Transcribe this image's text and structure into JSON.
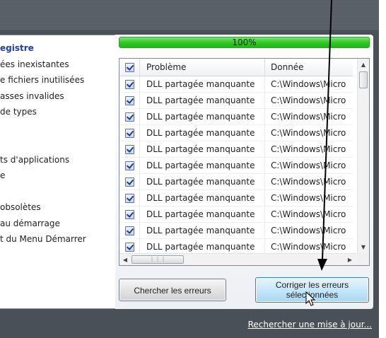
{
  "left_list": [
    {
      "text": "egistre",
      "head": true
    },
    {
      "text": "ées inexistantes"
    },
    {
      "text": "e fichiers inutilisées"
    },
    {
      "text": "asses invalides"
    },
    {
      "text": "de types"
    },
    {
      "text": ""
    },
    {
      "text": ""
    },
    {
      "text": "ts d'applications"
    },
    {
      "text": "e"
    },
    {
      "text": ""
    },
    {
      "text": "obsolètes"
    },
    {
      "text": "au démarrage"
    },
    {
      "text": "t du Menu Démarrer"
    }
  ],
  "progress": {
    "label": "100%",
    "value": 1.0
  },
  "grid": {
    "headers": {
      "check": "",
      "problem": "Problème",
      "data": "Donnée"
    },
    "rows": [
      {
        "problem": "DLL partagée manquante",
        "data": "C:\\Windows\\Micro"
      },
      {
        "problem": "DLL partagée manquante",
        "data": "C:\\Windows\\Micro"
      },
      {
        "problem": "DLL partagée manquante",
        "data": "C:\\Windows\\Micro"
      },
      {
        "problem": "DLL partagée manquante",
        "data": "C:\\Windows\\Micro"
      },
      {
        "problem": "DLL partagée manquante",
        "data": "C:\\Windows\\Micro"
      },
      {
        "problem": "DLL partagée manquante",
        "data": "C:\\Windows\\Micro"
      },
      {
        "problem": "DLL partagée manquante",
        "data": "C:\\Windows\\Micro"
      },
      {
        "problem": "DLL partagée manquante",
        "data": "C:\\Windows\\Micro"
      },
      {
        "problem": "DLL partagée manquante",
        "data": "C:\\Windows\\Micro"
      },
      {
        "problem": "DLL partagée manquante",
        "data": "C:\\Windows\\Micro"
      },
      {
        "problem": "DLL partagée manquante",
        "data": "C:\\Windows\\Micro"
      }
    ]
  },
  "buttons": {
    "scan": "Chercher les erreurs",
    "fix_line1": "Corriger les erreurs",
    "fix_line2": "sélectionnées"
  },
  "footer": {
    "update_link": "Rechercher une mise à jour..."
  },
  "colors": {
    "accent": "#1f3ea8",
    "progress": "#32c926",
    "frame": "#545b62"
  }
}
